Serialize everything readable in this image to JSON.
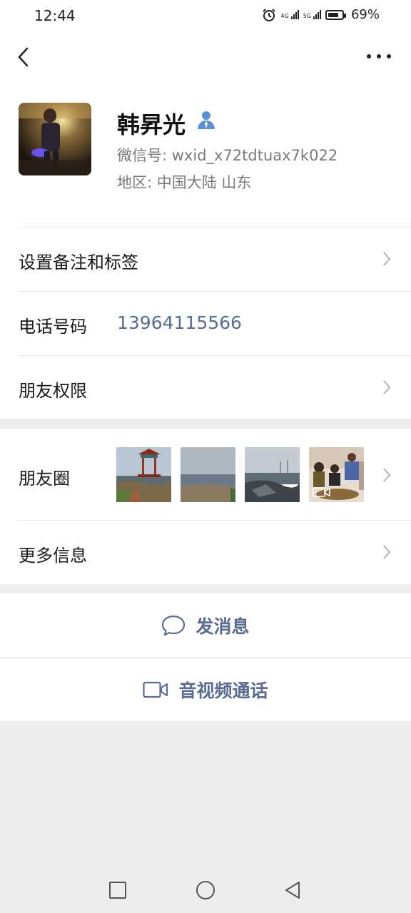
{
  "status_bar": {
    "time": "12:44",
    "signal1_label": "4G",
    "signal2_label": "5G",
    "battery": "69%",
    "icons": [
      "alarm-icon",
      "signal-icon",
      "battery-icon"
    ]
  },
  "profile": {
    "name": "韩昇光",
    "wechat_id": "微信号: wxid_x72tdtuax7k022",
    "region": "地区: 中国大陆  山东"
  },
  "rows": {
    "remark": "设置备注和标签",
    "phone_label": "电话号码",
    "phone_value": "13964115566",
    "permissions": "朋友权限",
    "moments": "朋友圈",
    "more_info": "更多信息"
  },
  "actions": {
    "message": "发消息",
    "call": "音视频通话"
  },
  "colors": {
    "link": "#576b95",
    "background": "#ededed",
    "text": "#191919",
    "secondary_text": "#7a7a7a"
  }
}
